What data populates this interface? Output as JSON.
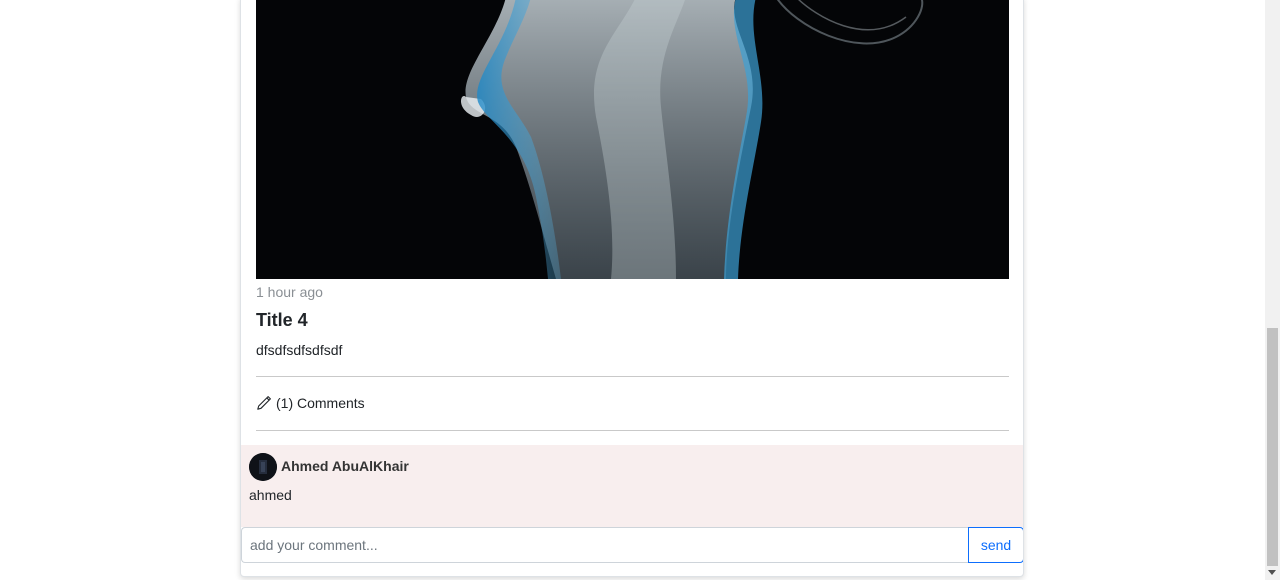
{
  "post": {
    "time": "1 hour ago",
    "title": "Title 4",
    "body": "dfsdfsdfsdfsdf",
    "comments_label": "(1) Comments"
  },
  "comment": {
    "author": "Ahmed AbuAlKhair",
    "text": "ahmed"
  },
  "form": {
    "placeholder": "add your comment...",
    "send_label": "send"
  },
  "colors": {
    "accent": "#0d6efd",
    "comment_bg": "#f8eeee"
  }
}
